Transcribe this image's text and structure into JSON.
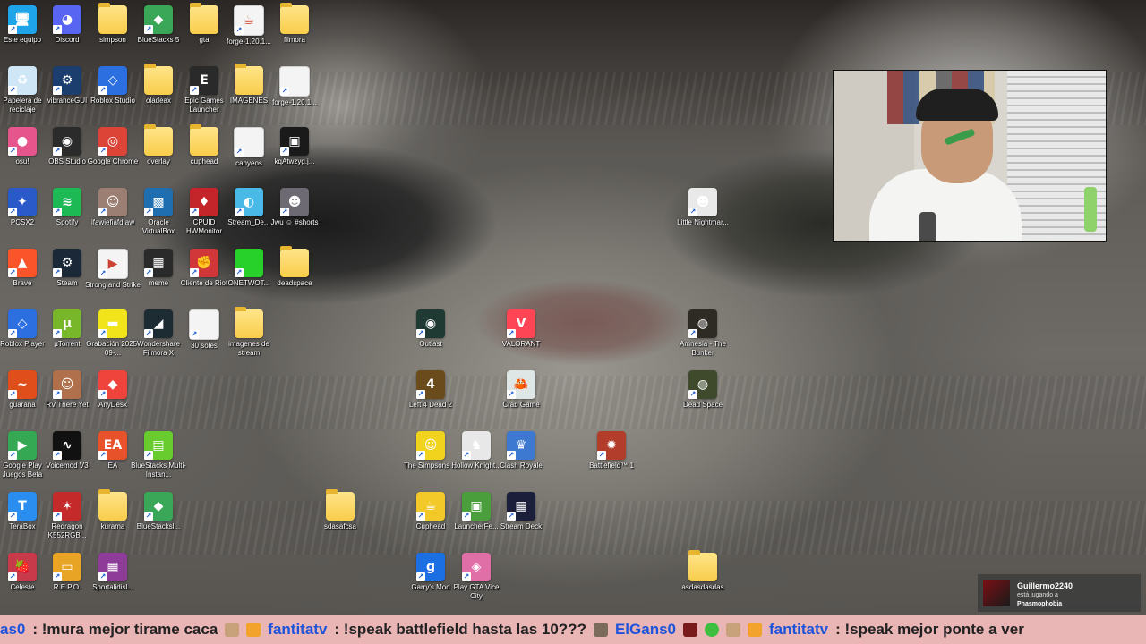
{
  "desktop": {
    "icons": [
      {
        "label": "Este equipo",
        "style": "solid",
        "color": "#1ea4e8",
        "glyph": "🖥"
      },
      {
        "label": "Discord",
        "style": "solid",
        "color": "#5865f2",
        "glyph": "◕"
      },
      {
        "label": "simpson",
        "style": "folder",
        "glyph": ""
      },
      {
        "label": "BlueStacks 5",
        "style": "solid",
        "color": "#3aa657",
        "glyph": "◆"
      },
      {
        "label": "gta",
        "style": "folder",
        "glyph": ""
      },
      {
        "label": "forge-1.20.1...",
        "style": "doc",
        "glyph": "☕"
      },
      {
        "label": "filmora",
        "style": "folder",
        "glyph": ""
      },
      {
        "label": "Papelera de reciclaje",
        "style": "solid",
        "color": "#cfe6f7",
        "glyph": "♻"
      },
      {
        "label": "vibranceGUI",
        "style": "solid",
        "color": "#1c3e6e",
        "glyph": "⚙"
      },
      {
        "label": "Roblox Studio",
        "style": "solid",
        "color": "#2c6fe0",
        "glyph": "◇"
      },
      {
        "label": "oladeax",
        "style": "folder",
        "glyph": ""
      },
      {
        "label": "Epic Games Launcher",
        "style": "solid",
        "color": "#2a2a2a",
        "glyph": "E"
      },
      {
        "label": "IMAGENES",
        "style": "folder",
        "glyph": ""
      },
      {
        "label": "forge-1.20.1...",
        "style": "doc",
        "glyph": ""
      },
      {
        "label": "osu!",
        "style": "solid",
        "color": "#e6568d",
        "glyph": "●"
      },
      {
        "label": "OBS Studio",
        "style": "solid",
        "color": "#2b2b2b",
        "glyph": "◉"
      },
      {
        "label": "Google Chrome",
        "style": "solid",
        "color": "#db4437",
        "glyph": "◎"
      },
      {
        "label": "overlay",
        "style": "folder",
        "glyph": ""
      },
      {
        "label": "cuphead",
        "style": "folder",
        "glyph": ""
      },
      {
        "label": "canyeos",
        "style": "doc",
        "glyph": ""
      },
      {
        "label": "kqAtwzyg.j...",
        "style": "solid",
        "color": "#1a1a1a",
        "glyph": "▣"
      },
      {
        "label": "PCSX2",
        "style": "solid",
        "color": "#2a59c9",
        "glyph": "✦"
      },
      {
        "label": "Spotify",
        "style": "solid",
        "color": "#1db954",
        "glyph": "≋"
      },
      {
        "label": "ifawiefiafd aw",
        "style": "solid",
        "color": "#9c7f73",
        "glyph": "☺"
      },
      {
        "label": "Oracle VirtualBox",
        "style": "solid",
        "color": "#1f6fb0",
        "glyph": "▩"
      },
      {
        "label": "CPUID HWMonitor",
        "style": "solid",
        "color": "#c4252b",
        "glyph": "♦"
      },
      {
        "label": "Stream_De...",
        "style": "solid",
        "color": "#49b9e8",
        "glyph": "◐"
      },
      {
        "label": "Jwu ☺ #shorts",
        "style": "solid",
        "color": "#6e6a74",
        "glyph": "☻"
      },
      {
        "label": "Brave",
        "style": "solid",
        "color": "#fb542b",
        "glyph": "▲"
      },
      {
        "label": "Steam",
        "style": "solid",
        "color": "#1b2838",
        "glyph": "⚙"
      },
      {
        "label": "Strong and Strike",
        "style": "doc",
        "glyph": "▶"
      },
      {
        "label": "meme",
        "style": "solid",
        "color": "#2a2a2a",
        "glyph": "▦"
      },
      {
        "label": "Cliente de Riot",
        "style": "solid",
        "color": "#d13639",
        "glyph": "✊"
      },
      {
        "label": "ONETWOT...",
        "style": "solid",
        "color": "#27d12a",
        "glyph": ""
      },
      {
        "label": "deadspace",
        "style": "folder",
        "glyph": ""
      },
      {
        "label": "Roblox Player",
        "style": "solid",
        "color": "#2c6fe0",
        "glyph": "◇"
      },
      {
        "label": "µTorrent",
        "style": "solid",
        "color": "#78b72a",
        "glyph": "µ"
      },
      {
        "label": "Grabación 2025-09-...",
        "style": "solid",
        "color": "#f1e41a",
        "glyph": "▬"
      },
      {
        "label": "Wondershare Filmora X",
        "style": "solid",
        "color": "#1d2b33",
        "glyph": "◢"
      },
      {
        "label": "30 soles",
        "style": "doc",
        "glyph": ""
      },
      {
        "label": "imagenes de stream",
        "style": "folder",
        "glyph": ""
      },
      {
        "label": "guarana",
        "style": "solid",
        "color": "#e04e1b",
        "glyph": "~"
      },
      {
        "label": "RV There Yet",
        "style": "solid",
        "color": "#b0704b",
        "glyph": "☺"
      },
      {
        "label": "AnyDesk",
        "style": "solid",
        "color": "#ef443b",
        "glyph": "◆"
      },
      {
        "label": "Google Play Juegos Beta",
        "style": "solid",
        "color": "#34a853",
        "glyph": "▶"
      },
      {
        "label": "Voicemod V3",
        "style": "solid",
        "color": "#111111",
        "glyph": "∿"
      },
      {
        "label": "EA",
        "style": "solid",
        "color": "#e8522b",
        "glyph": "EA"
      },
      {
        "label": "BlueStacks Multi-Instan...",
        "style": "solid",
        "color": "#69cc2e",
        "glyph": "▤"
      },
      {
        "label": "TeraBox",
        "style": "solid",
        "color": "#2a8df0",
        "glyph": "T"
      },
      {
        "label": "Redragon K552RGB...",
        "style": "solid",
        "color": "#c52a2a",
        "glyph": "✶"
      },
      {
        "label": "kurama",
        "style": "folder",
        "glyph": ""
      },
      {
        "label": "BlueStacksl...",
        "style": "solid",
        "color": "#3aa657",
        "glyph": "◆"
      },
      {
        "label": "sdasafcsa",
        "style": "folder",
        "glyph": ""
      },
      {
        "label": "Celeste",
        "style": "solid",
        "color": "#c83a4a",
        "glyph": "🍓"
      },
      {
        "label": "R.E.P.O.",
        "style": "solid",
        "color": "#e8a425",
        "glyph": "▭"
      },
      {
        "label": "Sportalidisl...",
        "style": "solid",
        "color": "#8e3b99",
        "glyph": "▦"
      },
      {
        "label": "Outlast",
        "style": "solid",
        "color": "#1f3a33",
        "glyph": "◉"
      },
      {
        "label": "VALORANT",
        "style": "solid",
        "color": "#fd4556",
        "glyph": "V"
      },
      {
        "label": "Amnesia - The Bunker",
        "style": "solid",
        "color": "#2e2a24",
        "glyph": "◍"
      },
      {
        "label": "Left 4 Dead 2",
        "style": "solid",
        "color": "#6a4b1b",
        "glyph": "4"
      },
      {
        "label": "Crab Game",
        "style": "solid",
        "color": "#dfe6e6",
        "glyph": "🦀"
      },
      {
        "label": "Dead Space",
        "style": "solid",
        "color": "#3f4a2c",
        "glyph": "◍"
      },
      {
        "label": "The Simpsons ...",
        "style": "solid",
        "color": "#f1d21c",
        "glyph": "☺"
      },
      {
        "label": "Hollow Knight...",
        "style": "solid",
        "color": "#e8e8e8",
        "glyph": "♞"
      },
      {
        "label": "Clash Royale",
        "style": "solid",
        "color": "#3d78d1",
        "glyph": "♛"
      },
      {
        "label": "Battlefield™ 1",
        "style": "solid",
        "color": "#b23d2b",
        "glyph": "✹"
      },
      {
        "label": "Cuphead",
        "style": "solid",
        "color": "#f3c829",
        "glyph": "☕"
      },
      {
        "label": "LauncherFe...",
        "style": "solid",
        "color": "#4a9e3c",
        "glyph": "▣"
      },
      {
        "label": "Stream Deck",
        "style": "solid",
        "color": "#1b1f3a",
        "glyph": "▦"
      },
      {
        "label": "Garry's Mod",
        "style": "solid",
        "color": "#1c6fe3",
        "glyph": "g"
      },
      {
        "label": "Play GTA Vice City",
        "style": "solid",
        "color": "#e06fa8",
        "glyph": "◈"
      },
      {
        "label": "Little Nightmar...",
        "style": "solid",
        "color": "#e9e9e9",
        "glyph": "☻"
      },
      {
        "label": "asdasdasdas",
        "style": "folder",
        "glyph": ""
      }
    ]
  },
  "notification": {
    "name": "Guillermo2240",
    "status": "está jugando a",
    "game": "Phasmophobia"
  },
  "chat_ticker": {
    "items": [
      {
        "user": "as0",
        "text": ": !mura mejor tirame caca"
      },
      {
        "user": "fantitatv",
        "text": ": !speak battlefield hasta las 10???"
      },
      {
        "user": "ElGans0",
        "text": ""
      },
      {
        "user": "fantitatv",
        "text": ": !speak mejor ponte a ver"
      }
    ]
  },
  "colors": {
    "ticker_bg": "#e9b5b5",
    "ticker_user": "#1e54d9",
    "ticker_text": "#222222"
  }
}
